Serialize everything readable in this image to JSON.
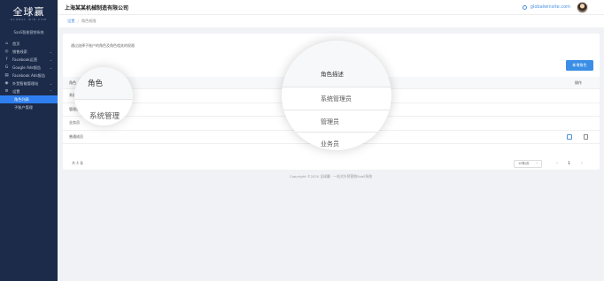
{
  "sidebar": {
    "logo": "全球赢",
    "logo_sub": "GLOBAL WIN.COM",
    "tagline": "SaaS智能营销系统",
    "items": [
      {
        "icon": "home-icon",
        "glyph": "⌂",
        "label": "首页",
        "arrow": ""
      },
      {
        "icon": "target-icon",
        "glyph": "◎",
        "label": "销售线索",
        "arrow": "⌄"
      },
      {
        "icon": "facebook-icon",
        "glyph": "f",
        "label": "Facebook运营",
        "arrow": "⌄"
      },
      {
        "icon": "google-icon",
        "glyph": "G",
        "label": "Google Ads报告",
        "arrow": "⌄"
      },
      {
        "icon": "chart-icon",
        "glyph": "▤",
        "label": "Facebook Ads报告",
        "arrow": ""
      },
      {
        "icon": "globe-icon",
        "glyph": "◉",
        "label": "外贸智能管理站",
        "arrow": "⌄"
      },
      {
        "icon": "gear-icon",
        "glyph": "⚙",
        "label": "设置",
        "arrow": "⌃"
      }
    ],
    "sub_items": [
      {
        "label": "角色列表",
        "active": true
      },
      {
        "label": "子账户管理",
        "active": false
      }
    ]
  },
  "topbar": {
    "company": "上海某某机械制造有限公司",
    "domain": "globalwinsite.com"
  },
  "breadcrumb": {
    "home": "设置",
    "separator": "/",
    "current": "角色权限"
  },
  "main": {
    "description": "通过选择子账户的角色及角色相关的权限",
    "add_button": "新增角色",
    "table": {
      "headers": {
        "role": "角色",
        "operation": "操作"
      },
      "rows": [
        {
          "role": "系统管理员"
        },
        {
          "role": "管理员"
        },
        {
          "role": "业务员"
        },
        {
          "role": "普通成员"
        }
      ]
    },
    "pager": {
      "total": "共 4 条",
      "page_size": "10条/页",
      "prev": "‹",
      "next": "›",
      "current_page": "1"
    }
  },
  "footer": "Copyright ©2020 全球赢 · 一站式外贸营销SaaS系统",
  "zoom_left": {
    "header": "角色",
    "row": "系统管理"
  },
  "zoom_right": {
    "header": "角色描述",
    "rows": [
      "系统管理员",
      "管理员",
      "业务员"
    ]
  },
  "colors": {
    "sidebar": "#1c2b4a",
    "accent": "#2f7ff0",
    "button": "#3a8ee6"
  }
}
